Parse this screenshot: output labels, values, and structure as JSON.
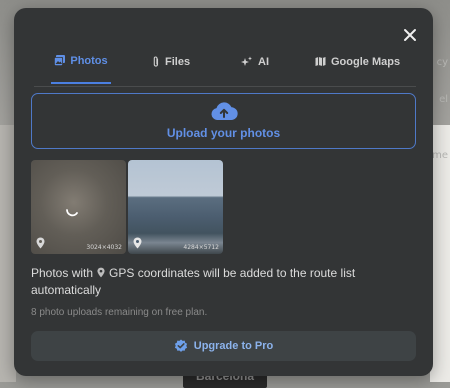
{
  "modal": {
    "tabs": [
      {
        "label": "Photos",
        "icon": "image-stack-icon",
        "active": true
      },
      {
        "label": "Files",
        "icon": "paperclip-icon",
        "active": false
      },
      {
        "label": "AI",
        "icon": "sparkle-icon",
        "active": false
      },
      {
        "label": "Google Maps",
        "icon": "map-icon",
        "active": false
      }
    ],
    "upload_label": "Upload your photos",
    "thumbnails": [
      {
        "dimensions": "3024×4032",
        "loading": true
      },
      {
        "dimensions": "4284×5712",
        "loading": false
      }
    ],
    "info_before": "Photos with",
    "info_after": "GPS coordinates will be added to the route list automatically",
    "remaining_text": "8 photo uploads remaining on free plan.",
    "upgrade_label": "Upgrade to Pro"
  },
  "background": {
    "side_text_1": "cy",
    "side_text_2": "el",
    "side_text_3": "time",
    "bottom_label": "Barcelona"
  },
  "colors": {
    "modal_bg": "#333536",
    "accent": "#5f8fe6",
    "upgrade_text": "#8cb3ec"
  }
}
